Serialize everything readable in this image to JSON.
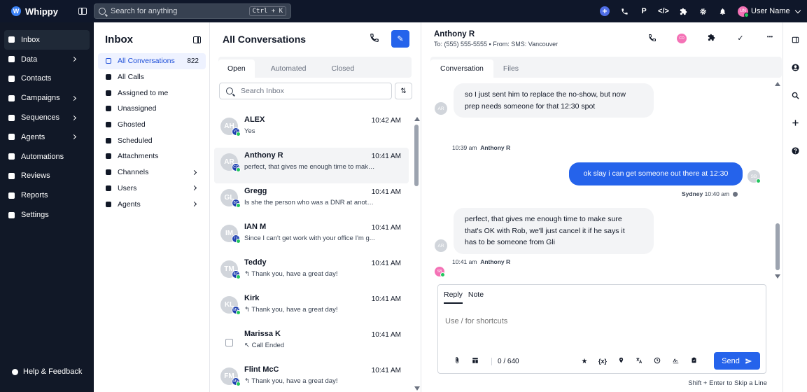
{
  "app": {
    "name": "Whippy",
    "logo_letter": "W"
  },
  "topbar": {
    "search_placeholder": "Search for anything",
    "shortcut": "Ctrl + K",
    "icons": [
      "plus-icon",
      "phone-icon",
      "p-icon",
      "code-icon",
      "puzzle-icon",
      "gear-icon",
      "bell-icon"
    ],
    "p_label": "P",
    "code_label": "</>",
    "user": {
      "initials": "UN",
      "name": "User Name",
      "avatar_color": "#f472b6"
    }
  },
  "leftnav": {
    "items": [
      {
        "label": "Inbox",
        "active": true
      },
      {
        "label": "Data",
        "has_chevron": true
      },
      {
        "label": "Contacts"
      },
      {
        "label": "Campaigns",
        "has_chevron": true
      },
      {
        "label": "Sequences",
        "has_chevron": true
      },
      {
        "label": "Agents",
        "has_chevron": true
      },
      {
        "label": "Automations"
      },
      {
        "label": "Reviews"
      },
      {
        "label": "Reports"
      },
      {
        "label": "Settings"
      }
    ],
    "help": "Help & Feedback"
  },
  "inbox": {
    "title": "Inbox",
    "items": [
      {
        "label": "All Conversations",
        "count": "822",
        "active": true
      },
      {
        "label": "All Calls"
      },
      {
        "label": "Assigned to me"
      },
      {
        "label": "Unassigned"
      },
      {
        "label": "Ghosted"
      },
      {
        "label": "Scheduled"
      },
      {
        "label": "Attachments"
      },
      {
        "label": "Channels",
        "has_chevron": true
      },
      {
        "label": "Users",
        "has_chevron": true
      },
      {
        "label": "Agents",
        "has_chevron": true
      }
    ]
  },
  "conversations": {
    "title": "All Conversations",
    "edit_icon": "✎",
    "tabs": [
      "Open",
      "Automated",
      "Closed"
    ],
    "search_placeholder": "Search Inbox",
    "sort_icon": "⇅",
    "list": [
      {
        "initials": "AH",
        "badge": "VC",
        "name": "ALEX",
        "time": "10:42 AM",
        "snippet": "Yes"
      },
      {
        "initials": "AR",
        "badge": "CO",
        "name": "Anthony R",
        "time": "10:41 AM",
        "snippet": "perfect, that gives me enough time to make ...",
        "active": true
      },
      {
        "initials": "GL",
        "badge": "BC",
        "name": "Gregg",
        "time": "10:41 AM",
        "snippet": "Is she the person who was a DNR at anothe..."
      },
      {
        "initials": "IM",
        "badge": "TC",
        "name": "IAN M",
        "time": "10:41 AM",
        "snippet": "Since I can't get work with your office I'm g..."
      },
      {
        "initials": "TM",
        "badge": "BC",
        "name": "Teddy",
        "time": "10:41 AM",
        "snippet": "↰ Thank you, have a great day!"
      },
      {
        "initials": "KL",
        "badge": "MV",
        "name": "Kirk",
        "time": "10:41 AM",
        "snippet": "↰ Thank you, have a great day!"
      },
      {
        "initials": "",
        "badge": "",
        "name": "Marissa K",
        "time": "10:41 AM",
        "snippet": "↖ Call Ended",
        "checkbox": true
      },
      {
        "initials": "FM",
        "badge": "MV",
        "name": "Flint McC",
        "time": "10:41 AM",
        "snippet": "↰ Thank you, have a great day!"
      }
    ]
  },
  "chat": {
    "contact_name": "Anthony R",
    "contact_meta": "To: (555) 555-5555  ▪  From: SMS: Vancouver",
    "header_avatar": "CO",
    "header_icons": [
      "phone-icon",
      "avatar-icon",
      "puzzle-icon",
      "check-icon",
      "more-icon"
    ],
    "check_glyph": "✓",
    "more_glyph": "•••",
    "tabs": [
      "Conversation",
      "Files"
    ],
    "messages": [
      {
        "text_lines": [
          "so I just sent him to replace the no-show, but now",
          "prep needs someone for that 12:30 spot"
        ],
        "time": "10:39 am",
        "author": "Anthony R",
        "avatar": "AR",
        "direction": "in"
      },
      {
        "text_lines": [
          "ok slay i can get someone out there at 12:30"
        ],
        "time": "10:40 am",
        "author": "Sydney",
        "avatar": "SB",
        "direction": "out"
      },
      {
        "text_lines": [
          "perfect, that gives me enough time to make sure",
          "that's OK with Rob, we'll just cancel it if he says it",
          "has to be someone from Gli"
        ],
        "time": "10:41 am",
        "author": "Anthony R",
        "avatar": "AR",
        "direction": "in"
      }
    ],
    "typing_avatar": "SB",
    "composer": {
      "tabs": [
        "Reply",
        "Note"
      ],
      "placeholder": "Use / for shortcuts",
      "char_count": "0 / 640",
      "tools": [
        "paperclip-icon",
        "template-icon",
        "star-icon",
        "variable-icon",
        "location-icon",
        "translate-icon",
        "clock-icon",
        "signature-icon",
        "clipboard-icon"
      ],
      "variable_label": "{x}",
      "send_label": "Send",
      "hint": "Shift + Enter to Skip a Line"
    }
  },
  "right_rail": {
    "icons": [
      "panel-icon",
      "user-circle-icon",
      "search-icon",
      "plus-icon",
      "help-icon"
    ]
  },
  "colors": {
    "accent": "#2563eb",
    "nav_bg": "#111827",
    "topbar_bg": "#0f172a",
    "online": "#22c55e"
  }
}
